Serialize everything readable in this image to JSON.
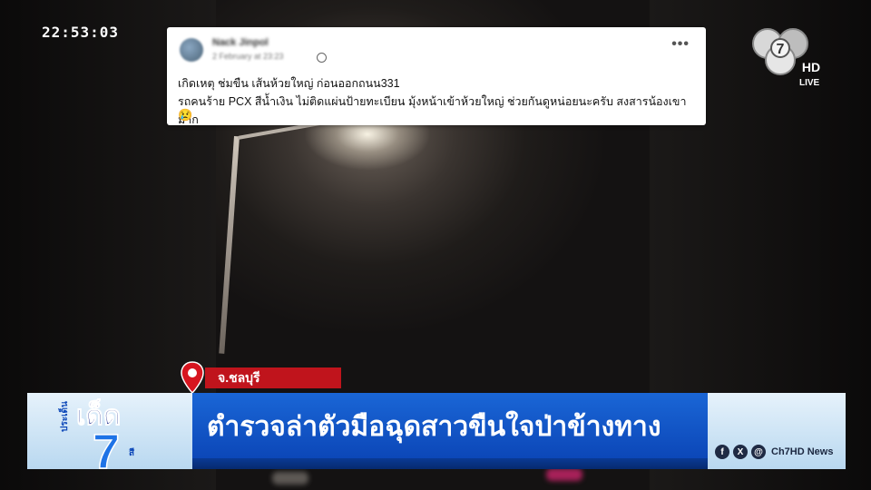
{
  "overlay": {
    "timecode": "22:53:03",
    "channel_live": "LIVE",
    "channel_logo_digit": "7",
    "channel_hd": "HD"
  },
  "post": {
    "author": "Nack Jinpol",
    "meta": "2 February at 23:23",
    "line1": "เกิดเหตุ ช่มขืน เส้นห้วยใหญ่ ก่อนออกถนน331",
    "line2": "รถคนร้าย PCX สีน้ำเงิน ไม่ติดแผ่นป้ายทะเบียน มุ้งหน้าเข้าห้วยใหญ่ ช่วยกันดูหน่อยนะครับ สงสารน้องเขามาก",
    "emoji": "😢",
    "more": "•••"
  },
  "lower_third": {
    "location": "จ.ชลบุรี",
    "headline": "ตำรวจล่าตัวมือฉุดสาวขืนใจป่าข้างทาง",
    "program_small": "ประเด็น",
    "program_big": "เด็ด",
    "program_number": "7",
    "program_suffix": "สี",
    "social_handle": "Ch7HD News"
  },
  "colors": {
    "headline_blue": "#0c47b8",
    "location_red": "#c0141c",
    "lower_third_light": "#cfe5f6"
  },
  "icons": [
    "location-pin-icon",
    "facebook-icon",
    "x-icon",
    "threads-icon",
    "globe-icon",
    "more-icon"
  ]
}
